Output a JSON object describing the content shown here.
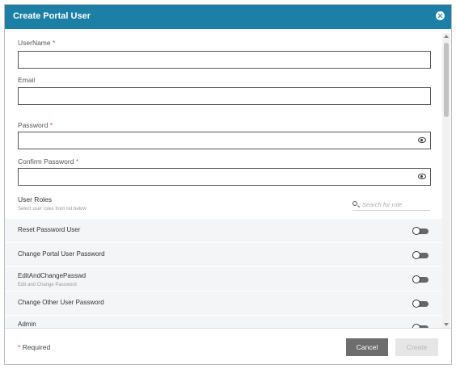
{
  "dialog": {
    "title": "Create Portal User"
  },
  "form": {
    "username": {
      "label": "UserName",
      "required_mark": "*",
      "value": ""
    },
    "email": {
      "label": "Email",
      "value": ""
    },
    "password": {
      "label": "Password",
      "required_mark": "*",
      "value": ""
    },
    "confirm_password": {
      "label": "Confirm Password",
      "required_mark": "*",
      "value": ""
    }
  },
  "roles": {
    "title": "User Roles",
    "subtitle": "Select user roles from list below",
    "search_placeholder": "Search for role",
    "items": [
      {
        "name": "Reset Password User",
        "description": "",
        "enabled": false
      },
      {
        "name": "Change Portal User Password",
        "description": "",
        "enabled": false
      },
      {
        "name": "EditAndChangePasswd",
        "description": "Edit and Change Password",
        "enabled": false
      },
      {
        "name": "Change Other User Password",
        "description": "",
        "enabled": false
      },
      {
        "name": "Admin",
        "description": "",
        "enabled": false
      }
    ]
  },
  "footer": {
    "required_mark": "*",
    "required_text": "Required",
    "cancel_label": "Cancel",
    "create_label": "Create"
  },
  "icons": {
    "close": "close-icon",
    "eye": "eye-icon",
    "search": "search-icon"
  },
  "colors": {
    "header": "#1b7fa6",
    "required": "#d9534f",
    "cancel_button": "#6d6d6d",
    "create_button_disabled": "#e6e6e6"
  }
}
